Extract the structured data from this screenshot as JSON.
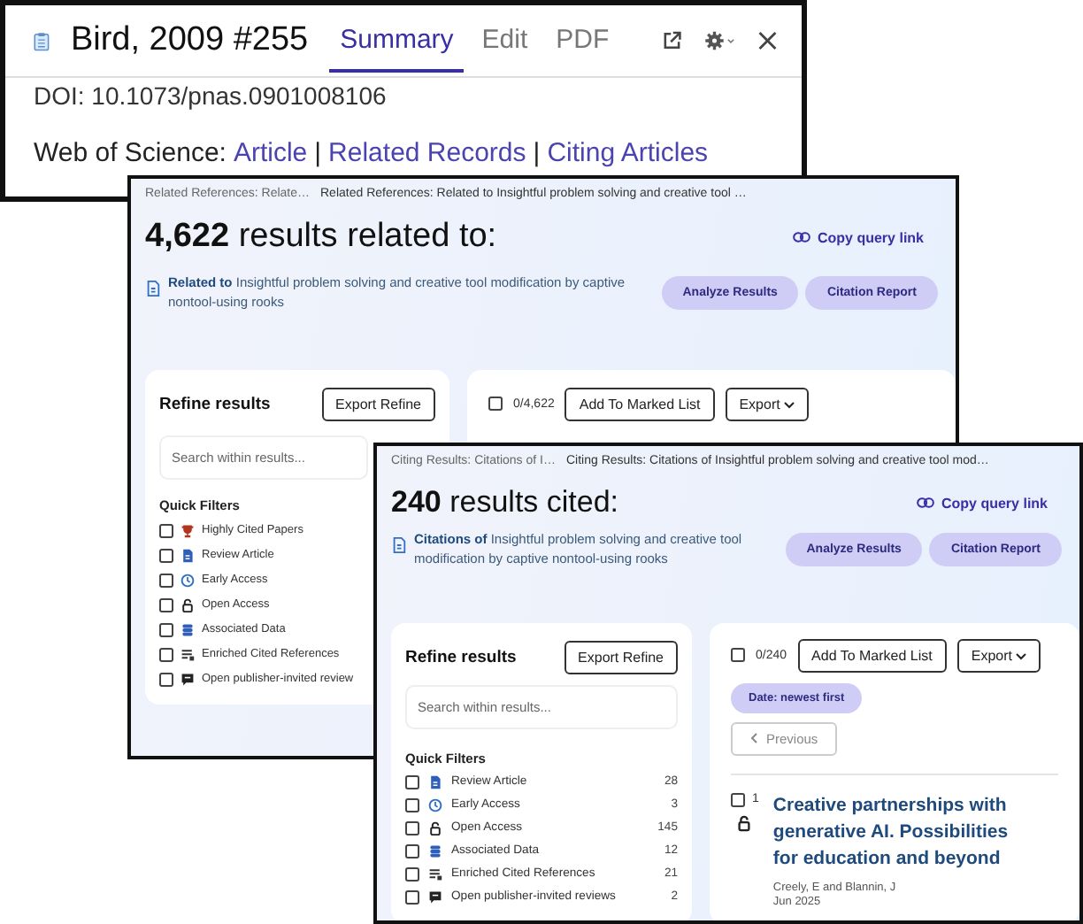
{
  "record_window": {
    "title": "Bird, 2009 #255",
    "tabs": [
      {
        "label": "Summary",
        "selected": true
      },
      {
        "label": "Edit",
        "selected": false
      },
      {
        "label": "PDF",
        "selected": false
      }
    ],
    "doi": "DOI: 10.1073/pnas.0901008106",
    "links_label": "Web of Science:",
    "links_separator": "|",
    "links": [
      "Article",
      "Related Records",
      "Citing Articles"
    ]
  },
  "related_window": {
    "breadcrumbs": [
      "Related References: Relate…",
      "Related References: Related to Insightful problem solving and creative tool …"
    ],
    "count": "4,622",
    "heading": "results related to:",
    "copy_link": "Copy query link",
    "query_prefix": "Related to",
    "query": "Insightful problem solving and creative tool modification by captive nontool-using rooks",
    "actions": [
      "Analyze Results",
      "Citation Report"
    ],
    "refine_title": "Refine results",
    "export_refine": "Export Refine",
    "search_placeholder": "Search within results...",
    "quick_filters_title": "Quick Filters",
    "filters": [
      {
        "kind": "trophy",
        "label": "Highly Cited Papers",
        "checked": false
      },
      {
        "kind": "review",
        "label": "Review Article",
        "checked": false
      },
      {
        "kind": "clock",
        "label": "Early Access",
        "checked": false
      },
      {
        "kind": "lock",
        "label": "Open Access",
        "checked": false
      },
      {
        "kind": "data",
        "label": "Associated Data",
        "checked": false
      },
      {
        "kind": "enriched",
        "label": "Enriched Cited References",
        "checked": false
      },
      {
        "kind": "comment",
        "label": "Open publisher-invited review",
        "checked": false
      }
    ],
    "select_count": "0/4,622",
    "select_checked": false,
    "add_to_list": "Add To Marked List",
    "export": "Export"
  },
  "citing_window": {
    "breadcrumbs": [
      "Citing Results: Citations of I…",
      "Citing Results: Citations of Insightful problem solving and creative tool mod…"
    ],
    "count": "240",
    "heading": "results cited:",
    "copy_link": "Copy query link",
    "query_prefix": "Citations of",
    "query": "Insightful problem solving and creative tool modification by captive nontool-using rooks",
    "actions": [
      "Analyze Results",
      "Citation Report"
    ],
    "refine_title": "Refine results",
    "export_refine": "Export Refine",
    "search_placeholder": "Search within results...",
    "quick_filters_title": "Quick Filters",
    "filters": [
      {
        "kind": "review",
        "label": "Review Article",
        "count": "28",
        "checked": false
      },
      {
        "kind": "clock",
        "label": "Early Access",
        "count": "3",
        "checked": false
      },
      {
        "kind": "lock",
        "label": "Open Access",
        "count": "145",
        "checked": false
      },
      {
        "kind": "data",
        "label": "Associated Data",
        "count": "12",
        "checked": false
      },
      {
        "kind": "enriched",
        "label": "Enriched Cited References",
        "count": "21",
        "checked": false
      },
      {
        "kind": "comment",
        "label": "Open publisher-invited reviews",
        "count": "2",
        "checked": false
      }
    ],
    "select_count": "0/240",
    "select_checked": false,
    "add_to_list": "Add To Marked List",
    "export": "Export",
    "sort": "Date: newest first",
    "previous": "Previous",
    "results": [
      {
        "index": "1",
        "checked": false,
        "open_access": true,
        "title": "Creative partnerships with generative AI. Possibilities for education and beyond",
        "authors": "Creely, E and Blannin, J",
        "date": "Jun 2025"
      }
    ]
  }
}
